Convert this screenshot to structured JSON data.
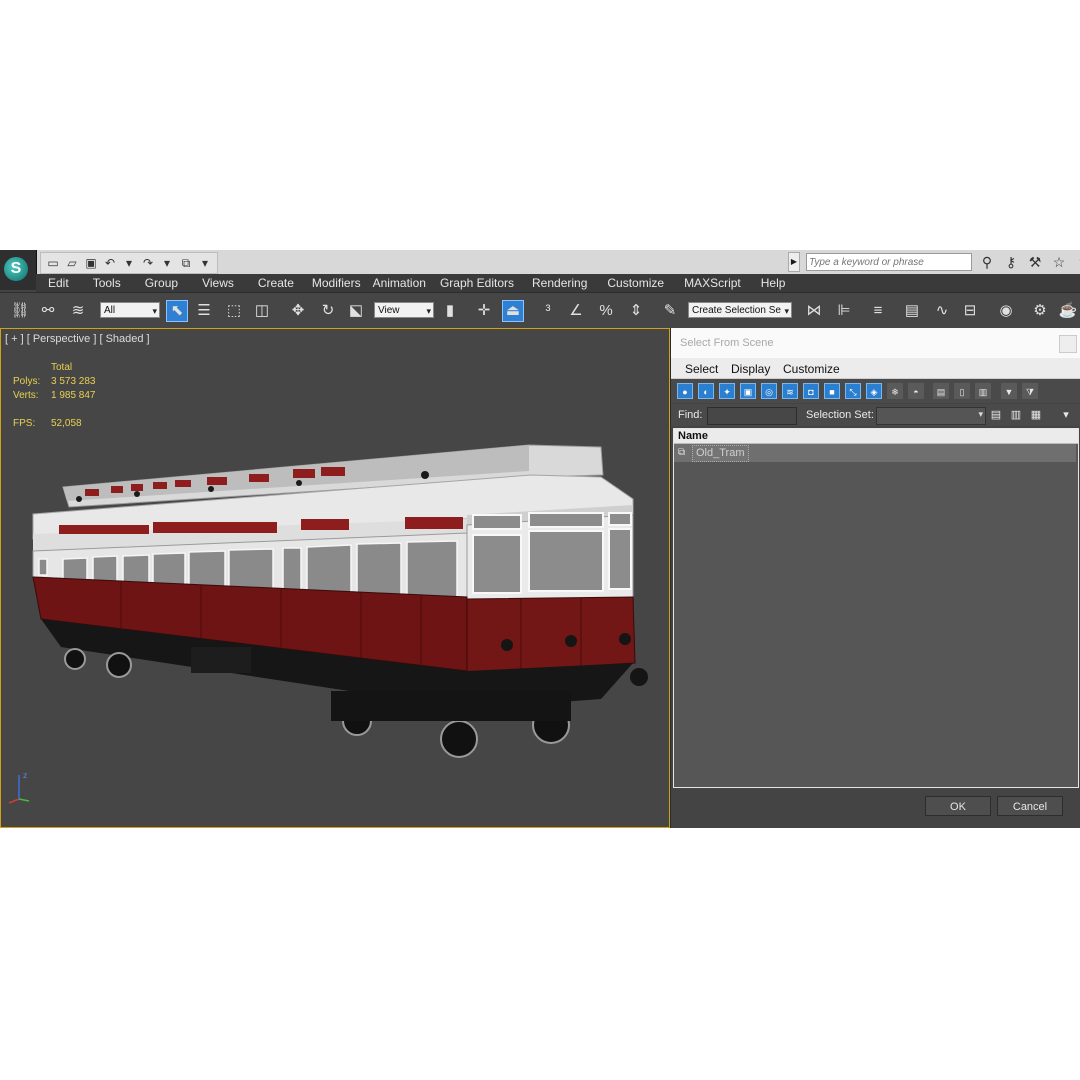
{
  "quick_access": {
    "icons": [
      "new-icon",
      "open-icon",
      "save-icon",
      "undo-icon",
      "redo-icon",
      "project-icon"
    ],
    "search_placeholder": "Type a keyword or phrase"
  },
  "menu": [
    "Edit",
    "Tools",
    "Group",
    "Views",
    "Create",
    "Modifiers",
    "Animation",
    "Graph Editors",
    "Rendering",
    "Customize",
    "MAXScript",
    "Help"
  ],
  "toolbar": {
    "selection_filter": "All",
    "reference_coord": "View",
    "named_selection": "Create Selection Se"
  },
  "viewport": {
    "label": "[ + ] [ Perspective ] [ Shaded ]",
    "stats": {
      "header": "Total",
      "polys_label": "Polys:",
      "polys": "3 573 283",
      "verts_label": "Verts:",
      "verts": "1 985 847",
      "fps_label": "FPS:",
      "fps": "52,058"
    },
    "axis_label": "z",
    "colors": {
      "stats": "#e8d150",
      "border_active": "#d0a21a",
      "tram_body": "#6e1414",
      "tram_roof": "#e6e6e6"
    }
  },
  "dialog": {
    "title": "Select From Scene",
    "menu": [
      "Select",
      "Display",
      "Customize"
    ],
    "find_label": "Find:",
    "selection_set_label": "Selection Set:",
    "column_header": "Name",
    "items": [
      "Old_Tram"
    ],
    "ok_label": "OK",
    "cancel_label": "Cancel"
  }
}
